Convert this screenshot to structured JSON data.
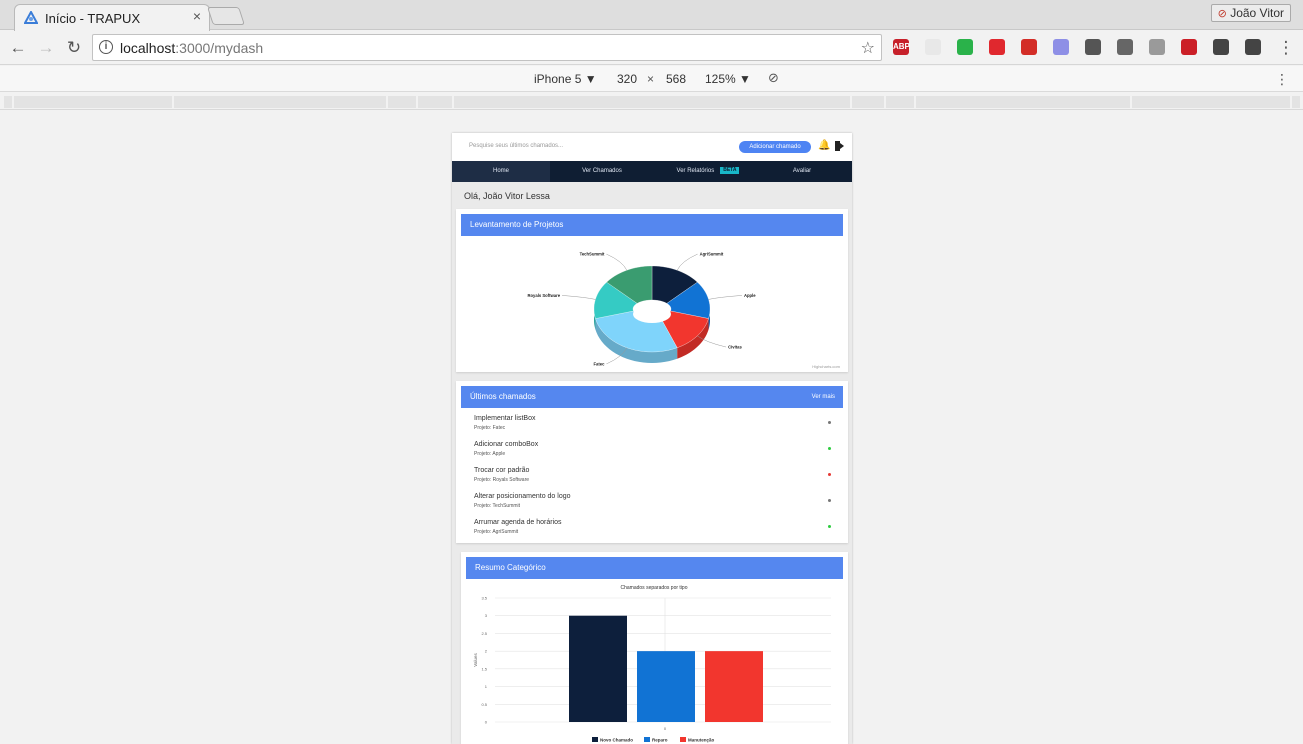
{
  "browser": {
    "tab_title": "Início - TRAPUX",
    "tab_close": "×",
    "profile_name": "João Vitor",
    "url_host": "localhost",
    "url_path": ":3000/mydash",
    "extensions": [
      {
        "name": "adblock-icon",
        "label": "ABP",
        "color": "#c7202a"
      },
      {
        "name": "eyedropper-ext-icon",
        "label": "",
        "color": "#e8e8e8"
      },
      {
        "name": "color-wheel-icon",
        "label": "",
        "color": "#2ab24a"
      },
      {
        "name": "opera-icon",
        "label": "",
        "color": "#e0282e"
      },
      {
        "name": "lastpass-icon",
        "label": "",
        "color": "#d32d27"
      },
      {
        "name": "lock-ext-icon",
        "label": "",
        "color": "#8e8fe6"
      },
      {
        "name": "pocket-icon",
        "label": "",
        "color": "#555555"
      },
      {
        "name": "picker-icon",
        "label": "",
        "color": "#666666"
      },
      {
        "name": "download-icon",
        "label": "",
        "color": "#9a9a9a"
      },
      {
        "name": "pinterest-icon",
        "label": "",
        "color": "#cb1f27"
      },
      {
        "name": "bug-icon",
        "label": "",
        "color": "#444444"
      },
      {
        "name": "bulb-icon",
        "label": "",
        "color": "#444444"
      }
    ]
  },
  "devtools": {
    "device": "iPhone 5 ▼",
    "width": "320",
    "times": "×",
    "height": "568",
    "zoom": "125% ▼"
  },
  "app": {
    "search_placeholder": "Pesquise seus últimos chamados...",
    "add_button": "Adicionar chamado",
    "nav": [
      "Home",
      "Ver Chamados",
      "Ver Relatórios",
      "Avaliar"
    ],
    "beta_badge": "BETA",
    "greeting": "Olá, João Vitor Lessa"
  },
  "projects_card": {
    "title": "Levantamento de Projetos",
    "credit": "Highcharts.com",
    "labels": [
      "AgriSummit",
      "Apple",
      "Civitas",
      "Fatec",
      "Royals Software",
      "TechSummit"
    ]
  },
  "calls_card": {
    "title": "Últimos chamados",
    "see_more": "Ver mais",
    "items": [
      {
        "title": "Implementar listBox",
        "project": "Projeto: Fatec",
        "status_color": "#777777"
      },
      {
        "title": "Adicionar comboBox",
        "project": "Projeto: Apple",
        "status_color": "#2ecc40"
      },
      {
        "title": "Trocar cor padrão",
        "project": "Projeto: Royals Software",
        "status_color": "#e53935"
      },
      {
        "title": "Alterar posicionamento do logo",
        "project": "Projeto: TechSummit",
        "status_color": "#777777"
      },
      {
        "title": "Arrumar agenda de horários",
        "project": "Projeto: AgriSummit",
        "status_color": "#2ecc40"
      }
    ]
  },
  "summary_card": {
    "title": "Resumo Categórico"
  },
  "chart_data": [
    {
      "type": "pie",
      "title": "",
      "labels": [
        "AgriSummit",
        "Apple",
        "Civitas",
        "Fatec",
        "Royals Software",
        "TechSummit"
      ],
      "values": [
        1,
        1,
        1,
        2,
        1,
        1
      ],
      "colors": [
        "#0d1f3c",
        "#1173d4",
        "#f2362e",
        "#7fd4fb",
        "#35cbc4",
        "#3a9c70"
      ],
      "donut": true,
      "3d": true
    },
    {
      "type": "bar",
      "title": "Chamados separados por tipo",
      "categories": [
        "0"
      ],
      "series": [
        {
          "name": "Novo Chamado",
          "values": [
            3
          ],
          "color": "#0d1f3c"
        },
        {
          "name": "Reparo",
          "values": [
            2
          ],
          "color": "#1173d4"
        },
        {
          "name": "Manutenção",
          "values": [
            2
          ],
          "color": "#f2362e"
        }
      ],
      "ylabel": "Values",
      "ylim": [
        0,
        3.5
      ],
      "yticks": [
        "0",
        "0.5",
        "1",
        "1.5",
        "2",
        "2.5",
        "3",
        "3.5"
      ],
      "grid": true,
      "legend": "bottom"
    }
  ]
}
